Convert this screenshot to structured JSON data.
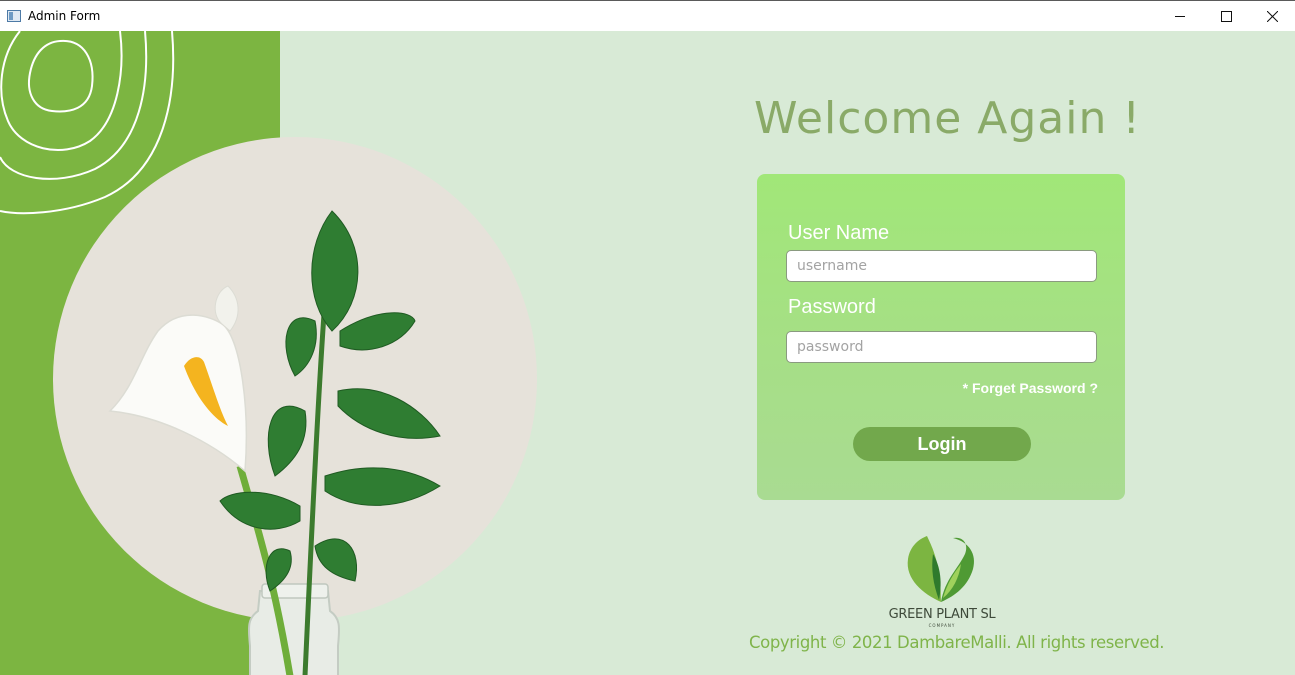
{
  "window": {
    "title": "Admin Form",
    "icon": "app-window-icon",
    "controls": [
      "minimize-icon",
      "maximize-icon",
      "close-icon"
    ]
  },
  "colors": {
    "accent_green": "#7cb541",
    "background": "#d8ead6",
    "card_top": "#a1e778",
    "card_bottom": "#a9db92",
    "button": "#72a84c",
    "heading": "#8aaa68",
    "copyright": "#7fb44a"
  },
  "welcome": {
    "heading": "Welcome Again !"
  },
  "login": {
    "username_label": "User Name",
    "username_placeholder": "username",
    "username_value": "",
    "password_label": "Password",
    "password_placeholder": "password",
    "password_value": "",
    "forget_password": "* Forget Password ?",
    "login_button": "Login"
  },
  "brand": {
    "logo_icon": "leaf-heart-icon",
    "company_name": "GREEN PLANT SL",
    "company_tagline": "COMPANY",
    "copyright": "Copyright ©  2021 DambareMalli. All rights reserved."
  },
  "decor": {
    "rings_icon": "concentric-rings-icon",
    "plant_image": "calla-lily-plant-image"
  }
}
